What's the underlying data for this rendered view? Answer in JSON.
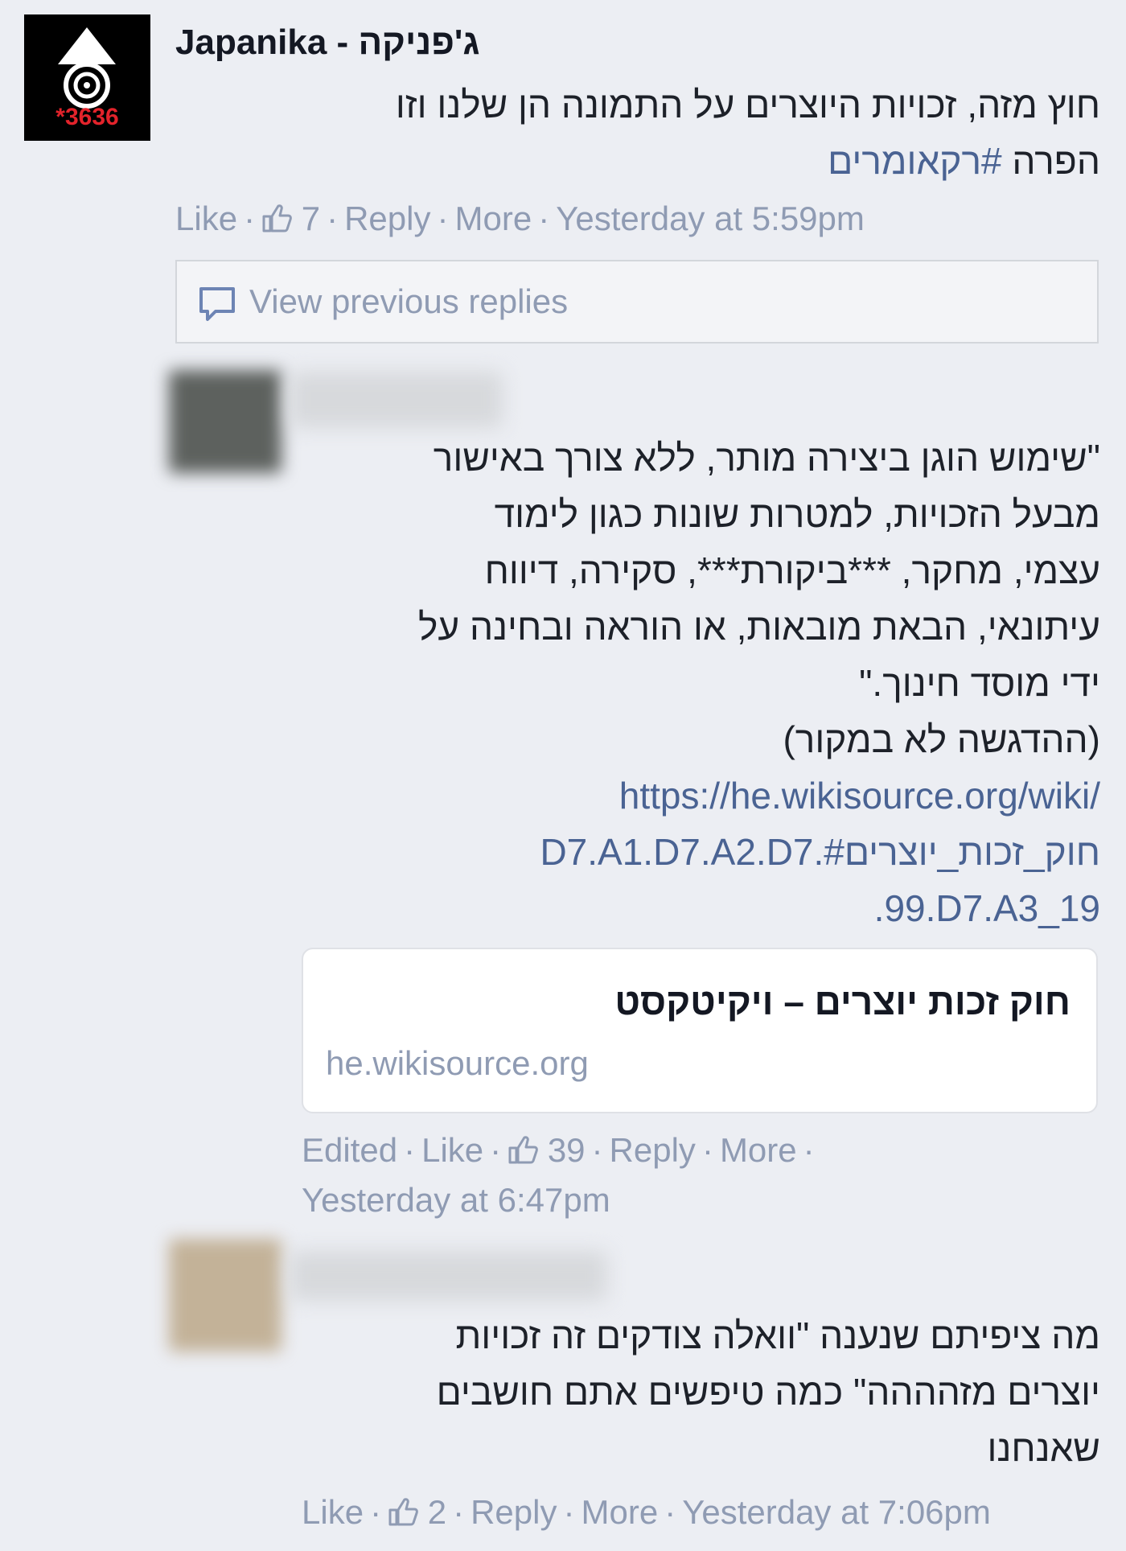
{
  "post": {
    "author": "Japanika - ג'פניקה",
    "avatar_text": "*3636",
    "text_line1": "חוץ מזה, זכויות היוצרים על התמונה הן שלנו וזו",
    "text_line2_prefix": "הפרה ",
    "hashtag": "#רקאומרים",
    "actions": {
      "like": "Like",
      "likes": "7",
      "reply": "Reply",
      "more": "More",
      "time": "Yesterday at 5:59pm"
    }
  },
  "view_previous": "View previous replies",
  "reply1": {
    "lines": [
      "\"שימוש הוגן ביצירה מותר, ללא צורך באישור",
      "מבעל הזכויות, למטרות שונות כגון לימוד",
      "עצמי, מחקר, ***ביקורת***, סקירה, דיווח",
      "עיתונאי, הבאת מובאות, או הוראה ובחינה על",
      "ידי מוסד חינוך.\"",
      "(ההדגשה לא במקור)"
    ],
    "link_lines": [
      "https://he.wikisource.org/wiki/",
      "חוק_זכות_יוצרים#.D7.A1.D7.A2.D7",
      ".99.D7.A3_19"
    ],
    "card": {
      "title": "חוק זכות יוצרים – ויקיטקסט",
      "domain": "he.wikisource.org"
    },
    "actions": {
      "edited": "Edited",
      "like": "Like",
      "likes": "39",
      "reply": "Reply",
      "more": "More",
      "time": "Yesterday at 6:47pm"
    }
  },
  "reply2": {
    "lines": [
      "מה ציפיתם שנענה \"וואלה צודקים זה זכויות",
      "יוצרים מזהההה\" כמה טיפשים אתם חושבים",
      "שאנחנו"
    ],
    "actions": {
      "like": "Like",
      "likes": "2",
      "reply": "Reply",
      "more": "More",
      "time": "Yesterday at 7:06pm"
    }
  },
  "colors": {
    "background": "#eceef3",
    "link": "#4a6393",
    "meta": "#8f9bb3"
  }
}
